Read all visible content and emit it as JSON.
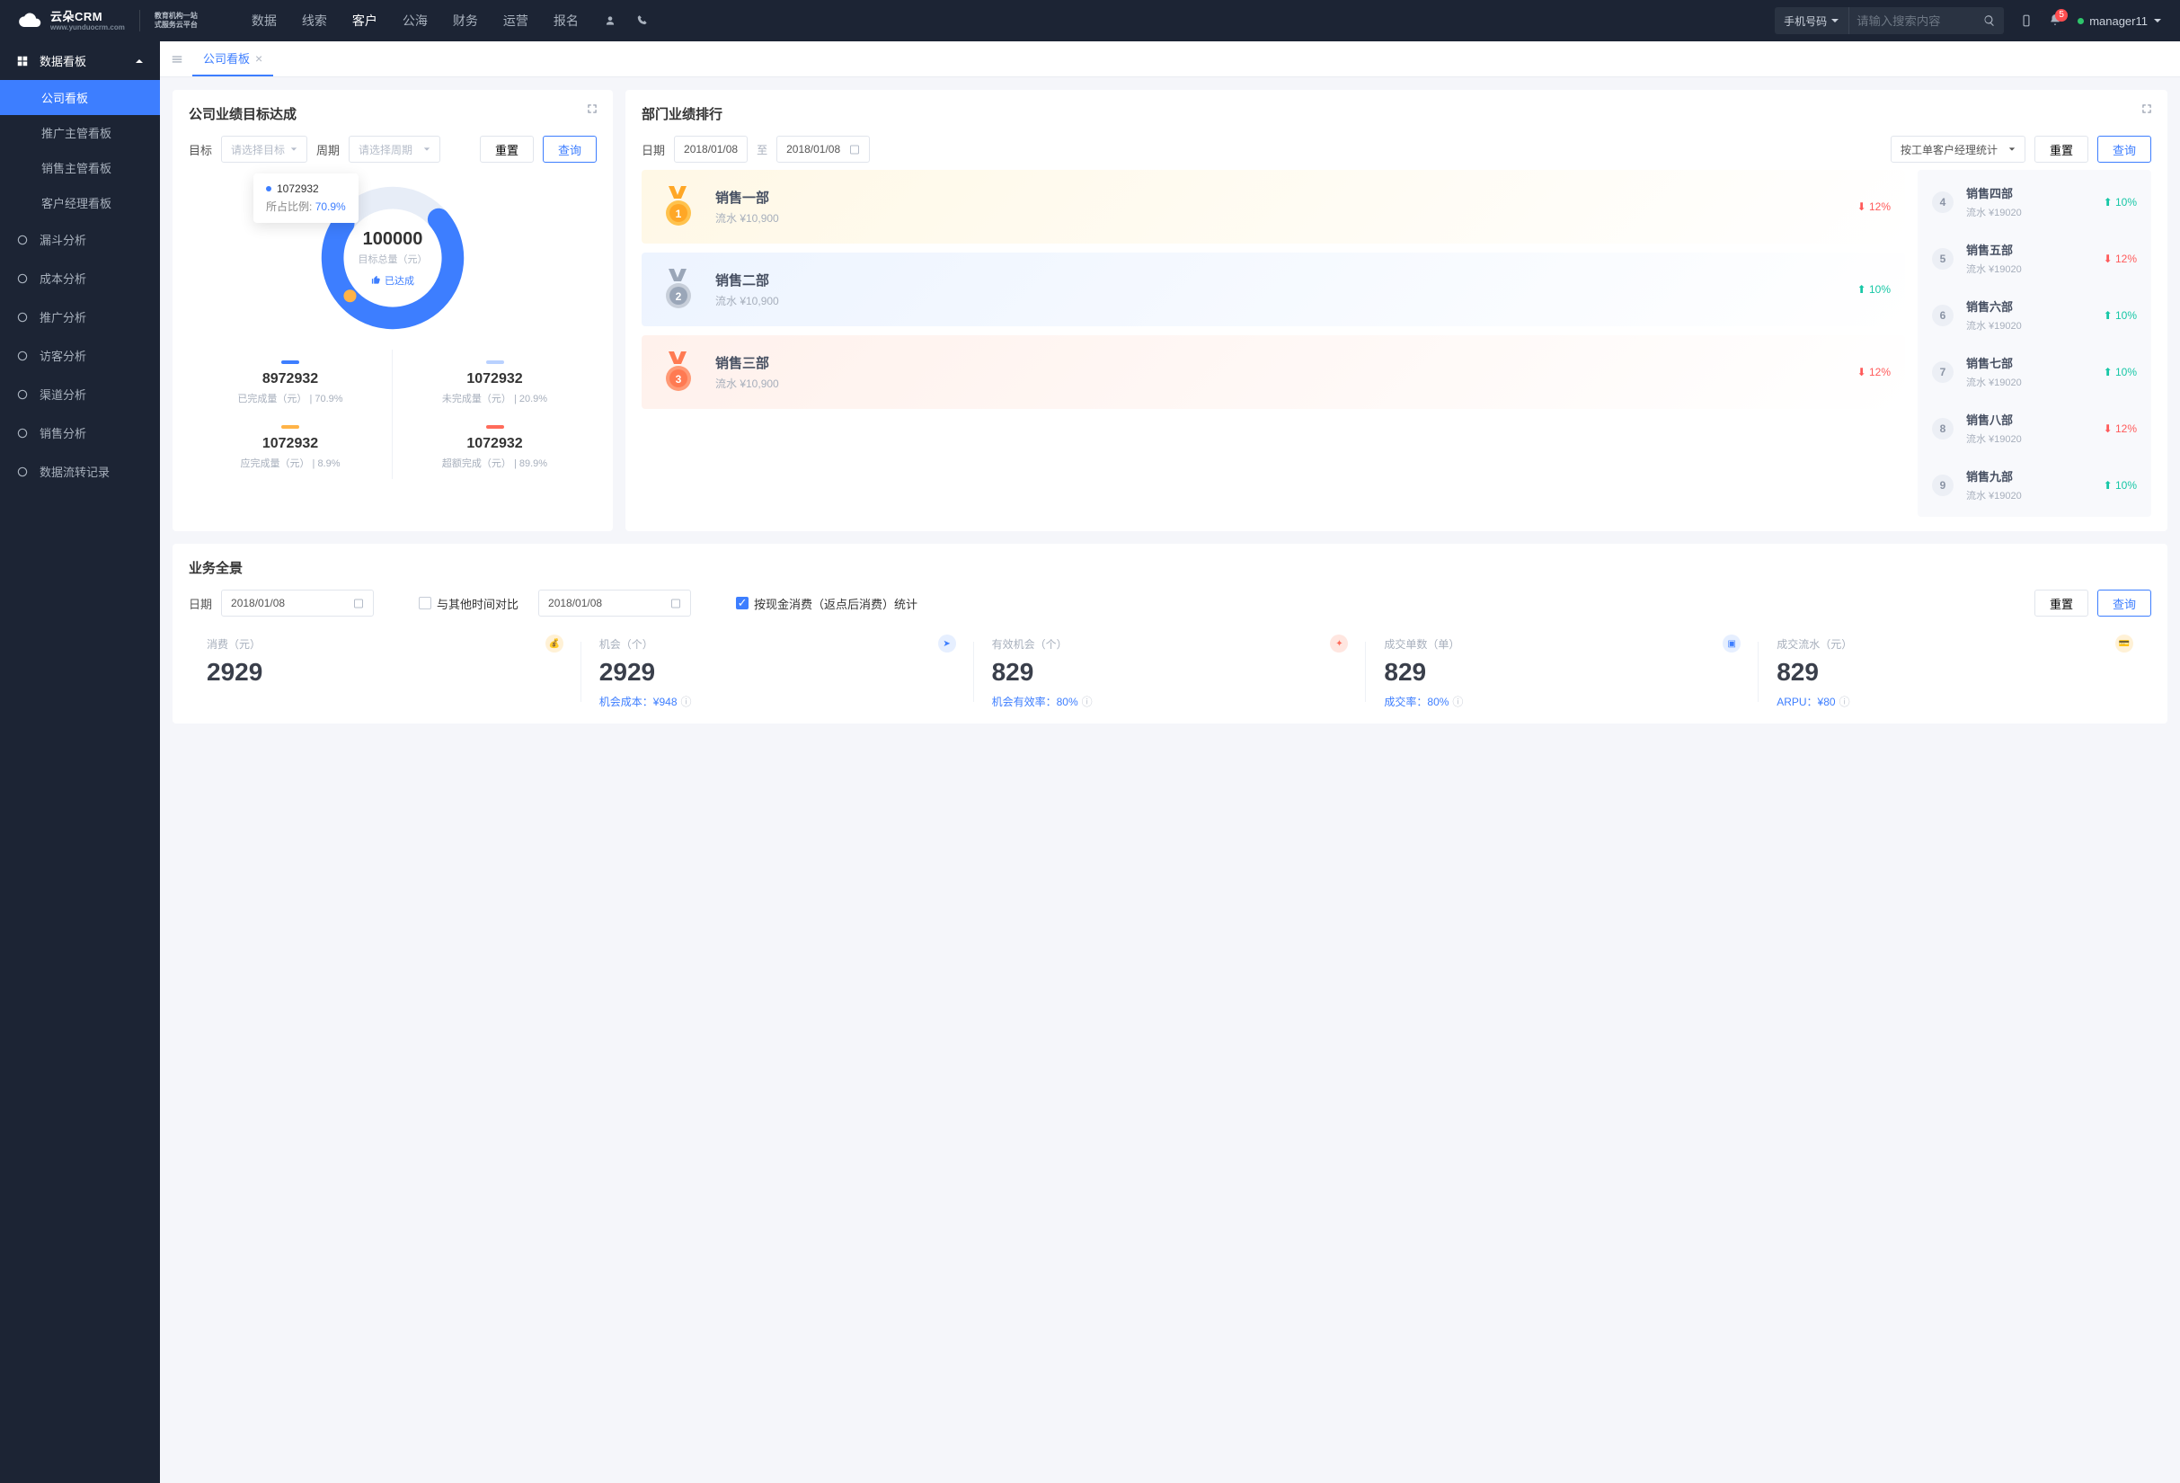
{
  "header": {
    "logo_main": "云朵CRM",
    "logo_sub": "www.yunduocrm.com",
    "logo_right1": "教育机构一站",
    "logo_right2": "式服务云平台",
    "nav": [
      "数据",
      "线索",
      "客户",
      "公海",
      "财务",
      "运营",
      "报名"
    ],
    "nav_active_index": 2,
    "search_type": "手机号码",
    "search_placeholder": "请输入搜索内容",
    "notif_count": "5",
    "user": "manager11"
  },
  "sidebar": {
    "group1": "数据看板",
    "subs": [
      "公司看板",
      "推广主管看板",
      "销售主管看板",
      "客户经理看板"
    ],
    "sub_active": 0,
    "items": [
      "漏斗分析",
      "成本分析",
      "推广分析",
      "访客分析",
      "渠道分析",
      "销售分析",
      "数据流转记录"
    ]
  },
  "tab": {
    "label": "公司看板"
  },
  "panel_target": {
    "title": "公司业绩目标达成",
    "label_target": "目标",
    "select_target": "请选择目标",
    "label_period": "周期",
    "select_period": "请选择周期",
    "btn_reset": "重置",
    "btn_query": "查询",
    "tooltip_val": "1072932",
    "tooltip_label": "所占比例:",
    "tooltip_pct": "70.9%",
    "center_val": "100000",
    "center_sub": "目标总量（元）",
    "center_tag": "已达成",
    "metrics": [
      {
        "bar": "#3d7eff",
        "val": "8972932",
        "desc": "已完成量（元）  |  70.9%"
      },
      {
        "bar": "#b9d1ff",
        "val": "1072932",
        "desc": "未完成量（元）  |  20.9%"
      },
      {
        "bar": "#ffb347",
        "val": "1072932",
        "desc": "应完成量（元）  |  8.9%"
      },
      {
        "bar": "#ff6b5a",
        "val": "1072932",
        "desc": "超额完成（元）  |  89.9%"
      }
    ]
  },
  "chart_data": {
    "type": "pie",
    "title": "公司业绩目标达成",
    "center_label": "目标总量（元）",
    "center_value": 100000,
    "status": "已达成",
    "series": [
      {
        "name": "已完成量（元）",
        "value": 8972932,
        "pct": 70.9,
        "color": "#3d7eff"
      },
      {
        "name": "未完成量（元）",
        "value": 1072932,
        "pct": 20.9,
        "color": "#b9d1ff"
      },
      {
        "name": "应完成量（元）",
        "value": 1072932,
        "pct": 8.9,
        "color": "#ffb347"
      },
      {
        "name": "超额完成（元）",
        "value": 1072932,
        "pct": 89.9,
        "color": "#ff6b5a"
      }
    ]
  },
  "panel_rank": {
    "title": "部门业绩排行",
    "label_date": "日期",
    "date_from": "2018/01/08",
    "to": "至",
    "date_to": "2018/01/08",
    "select_type": "按工单客户经理统计",
    "btn_reset": "重置",
    "btn_query": "查询",
    "top": [
      {
        "name": "销售一部",
        "sub": "流水 ¥10,900",
        "pct": "12%",
        "dir": "down"
      },
      {
        "name": "销售二部",
        "sub": "流水 ¥10,900",
        "pct": "10%",
        "dir": "up"
      },
      {
        "name": "销售三部",
        "sub": "流水 ¥10,900",
        "pct": "12%",
        "dir": "down"
      }
    ],
    "rest": [
      {
        "no": "4",
        "name": "销售四部",
        "sub": "流水 ¥19020",
        "pct": "10%",
        "dir": "up"
      },
      {
        "no": "5",
        "name": "销售五部",
        "sub": "流水 ¥19020",
        "pct": "12%",
        "dir": "down"
      },
      {
        "no": "6",
        "name": "销售六部",
        "sub": "流水 ¥19020",
        "pct": "10%",
        "dir": "up"
      },
      {
        "no": "7",
        "name": "销售七部",
        "sub": "流水 ¥19020",
        "pct": "10%",
        "dir": "up"
      },
      {
        "no": "8",
        "name": "销售八部",
        "sub": "流水 ¥19020",
        "pct": "12%",
        "dir": "down"
      },
      {
        "no": "9",
        "name": "销售九部",
        "sub": "流水 ¥19020",
        "pct": "10%",
        "dir": "up"
      }
    ]
  },
  "panel_overview": {
    "title": "业务全景",
    "label_date": "日期",
    "date1": "2018/01/08",
    "compare_label": "与其他时间对比",
    "date2": "2018/01/08",
    "stat_label": "按现金消费（返点后消费）统计",
    "btn_reset": "重置",
    "btn_query": "查询",
    "kpis": [
      {
        "label": "消费（元）",
        "val": "2929",
        "foot": "",
        "icon_bg": "#fff1d6",
        "icon_fg": "#f2a93c",
        "glyph": "💰"
      },
      {
        "label": "机会（个）",
        "val": "2929",
        "foot": "机会成本：¥948",
        "icon_bg": "#e6efff",
        "icon_fg": "#3d7eff",
        "glyph": "➤"
      },
      {
        "label": "有效机会（个）",
        "val": "829",
        "foot": "机会有效率：80%",
        "icon_bg": "#ffe6e0",
        "icon_fg": "#ff6b5a",
        "glyph": "✦"
      },
      {
        "label": "成交单数（单）",
        "val": "829",
        "foot": "成交率：80%",
        "icon_bg": "#e6efff",
        "icon_fg": "#3d7eff",
        "glyph": "▣"
      },
      {
        "label": "成交流水（元）",
        "val": "829",
        "foot": "ARPU：¥80",
        "icon_bg": "#fff1d6",
        "icon_fg": "#f2a93c",
        "glyph": "💳"
      }
    ]
  }
}
